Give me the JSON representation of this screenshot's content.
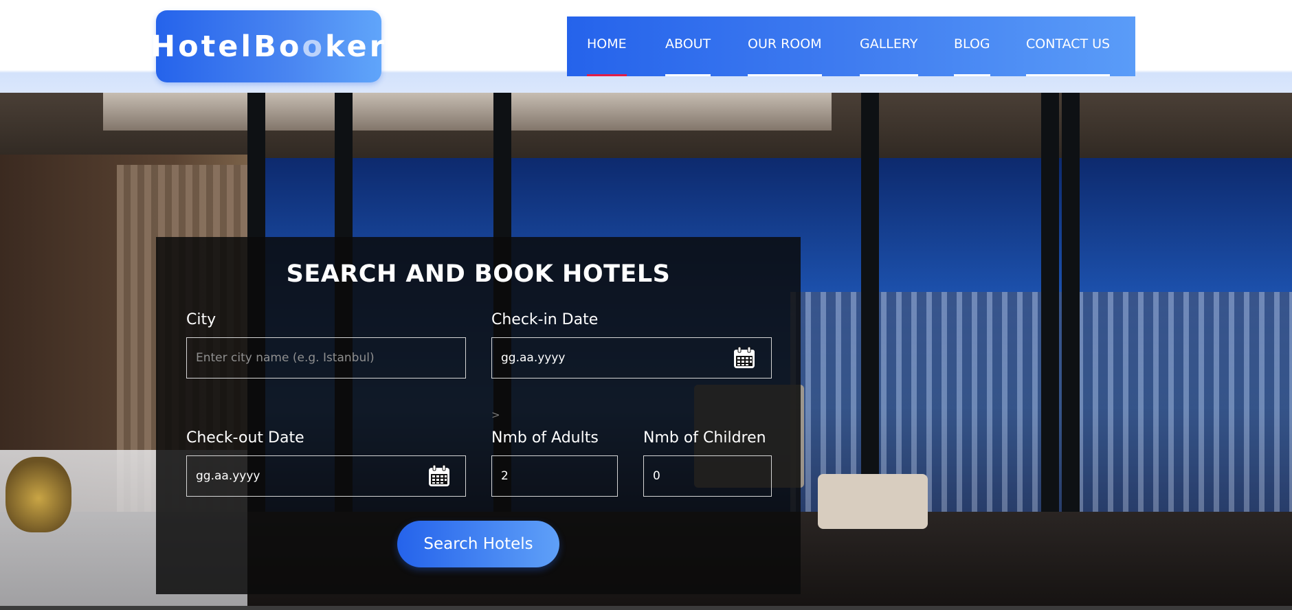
{
  "brand": {
    "part1": "HotelBo",
    "part2": "o",
    "part3": "ker"
  },
  "nav": {
    "home": "HOME",
    "about": "ABOUT",
    "our_room": "OUR ROOM",
    "gallery": "GALLERY",
    "blog": "BLOG",
    "contact_us": "CONTACT US",
    "active": "HOME"
  },
  "search": {
    "title": "SEARCH AND BOOK HOTELS",
    "city_label": "City",
    "city_placeholder": "Enter city name (e.g. Istanbul)",
    "checkin_label": "Check-in Date",
    "checkin_value": "gg.aa.yyyy",
    "checkout_label": "Check-out Date",
    "checkout_value": "gg.aa.yyyy",
    "adults_label": "Nmb of Adults",
    "adults_value": "2",
    "children_label": "Nmb of Children",
    "children_value": "0",
    "stray_text": ">",
    "button_label": "Search Hotels"
  },
  "colors": {
    "accent": "#2563eb",
    "accent_light": "#60a5fa",
    "active_underline": "#e11d48"
  },
  "icons": {
    "date_picker": "calendar-icon"
  }
}
